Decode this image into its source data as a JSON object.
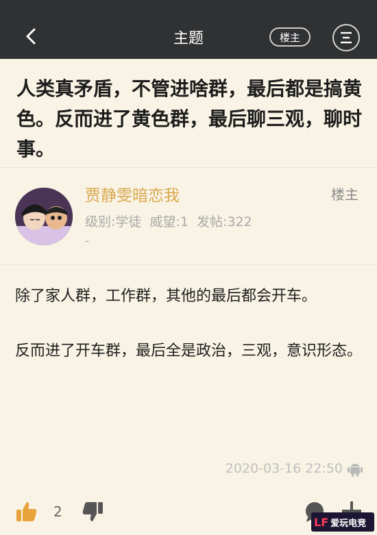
{
  "header": {
    "title": "主题",
    "op_button": "楼主",
    "back_icon": "chevron-left-icon",
    "menu_icon": "menu-icon"
  },
  "post": {
    "title": "人类真矛盾，不管进啥群，最后都是搞黄色。反而进了黄色群，最后聊三观，聊时事。"
  },
  "author": {
    "name": "贾静雯暗恋我",
    "badge": "楼主",
    "stats": "级别:学徒  威望:1  发帖:322",
    "extra": "-"
  },
  "content": {
    "paragraphs": [
      "除了家人群，工作群，其他的最后都会开车。",
      "反而进了开车群，最后全是政治，三观，意识形态。"
    ],
    "timestamp": "2020-03-16 22:50",
    "device_icon": "android-icon"
  },
  "actions": {
    "like_count": "2",
    "like_icon": "thumbs-up-icon",
    "dislike_icon": "thumbs-down-icon",
    "comment_icon": "comment-icon",
    "add_icon": "plus-icon"
  },
  "watermark": {
    "logo": "LF",
    "text": "爱玩电竞"
  },
  "colors": {
    "topbar": "#2f3133",
    "background": "#f8f3e4",
    "author_name": "#d9a84f",
    "like_icon": "#e8a33a"
  }
}
